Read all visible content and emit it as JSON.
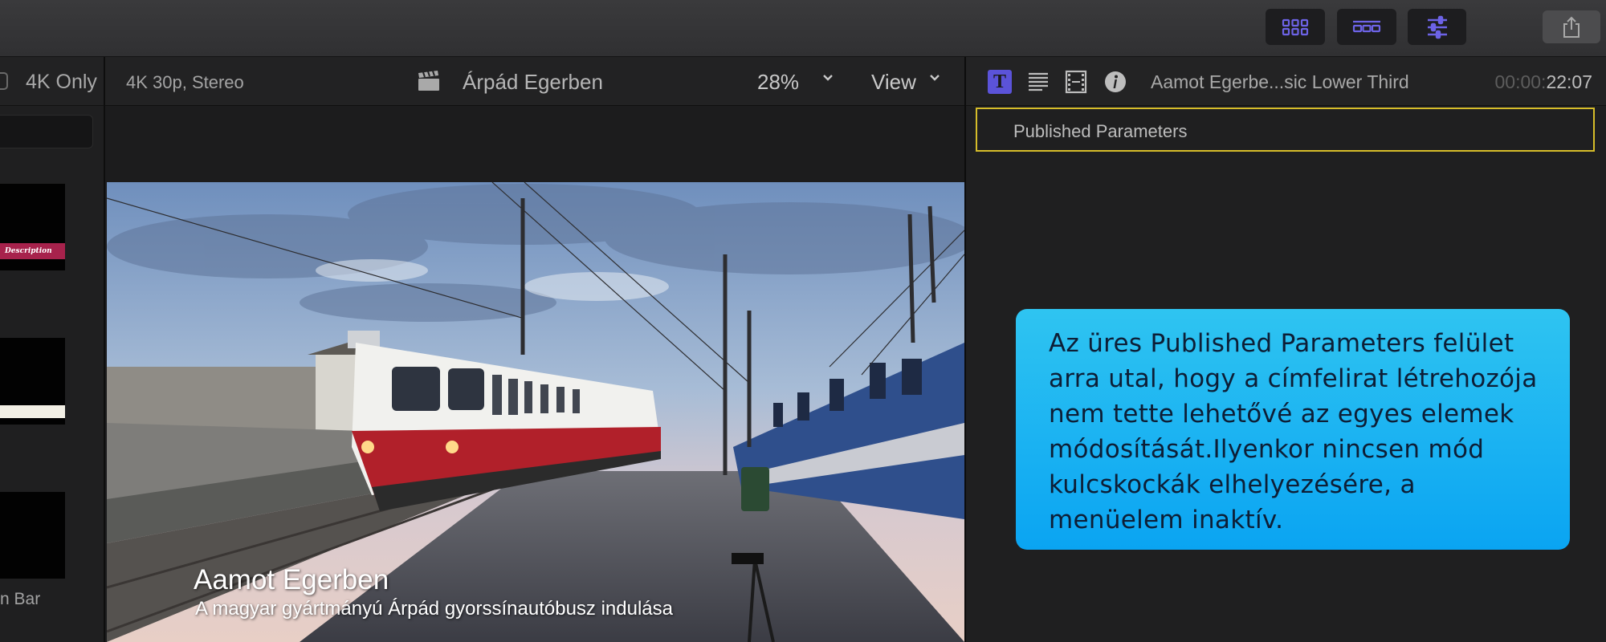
{
  "browser": {
    "only_4k_label": "4K Only",
    "thumbnails": [
      {
        "badge": "Description"
      },
      {
        "badge": ""
      },
      {
        "label": "n Bar"
      }
    ]
  },
  "viewer": {
    "format": "4K 30p, Stereo",
    "project_name": "Árpád Egerben",
    "zoom": "28%",
    "view_menu": "View",
    "lower_third": {
      "title": "Aamot Egerben",
      "subtitle": "A magyar gyártmányú Árpád gyorssínautóbusz indulása"
    }
  },
  "inspector": {
    "clip_name": "Aamot Egerbe...sic Lower Third",
    "timecode_dim": "00:00:",
    "timecode_bright": "22:07",
    "section_label": "Published Parameters",
    "callout": "Az üres Published Parameters felület arra utal, hogy a címfelirat létrehozója nem tette lehetővé az egyes elemek módosítását.Ilyenkor nincsen mód kulcskockák elhelyezésére, a menüelem inaktív."
  },
  "colors": {
    "accent": "#5b53d9",
    "highlight_border": "#d6bd2a",
    "callout_top": "#2fc4f1",
    "callout_bottom": "#0aa4f2"
  },
  "icons": [
    "browser-grid-icon",
    "timeline-icon",
    "inspector-sliders-icon",
    "share-icon",
    "clapper-icon",
    "chevron-down-icon",
    "title-inspector-icon",
    "text-inspector-icon",
    "video-inspector-icon",
    "info-inspector-icon"
  ]
}
